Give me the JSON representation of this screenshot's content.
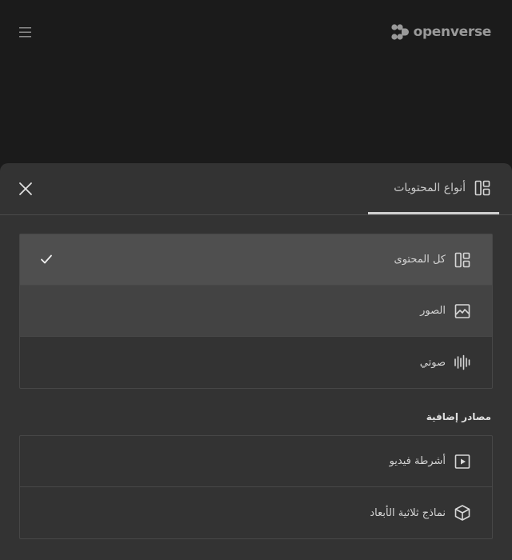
{
  "header": {
    "menu_icon": "menu-icon",
    "logo_text": "openverse",
    "logo_icon": "openverse-logo-icon"
  },
  "sheet": {
    "tab": {
      "label": "أنواع المحتويات",
      "icon": "content-types-icon"
    },
    "close_icon": "close-icon",
    "content_types": [
      {
        "label": "كل المحتوى",
        "icon": "all-content-icon",
        "selected": true
      },
      {
        "label": "الصور",
        "icon": "image-icon",
        "selected": false
      },
      {
        "label": "صوتي",
        "icon": "audio-icon",
        "selected": false
      }
    ],
    "additional_sources_title": "مصادر إضافية",
    "additional_sources": [
      {
        "label": "أشرطة فيديو",
        "icon": "video-icon"
      },
      {
        "label": "نماذج ثلاثية الأبعاد",
        "icon": "cube-icon"
      }
    ]
  },
  "colors": {
    "page_bg": "#1b1b1b",
    "sheet_bg": "#333333",
    "selected_bg": "#4f4f4f",
    "hover_bg": "#434343",
    "border": "#474747"
  }
}
